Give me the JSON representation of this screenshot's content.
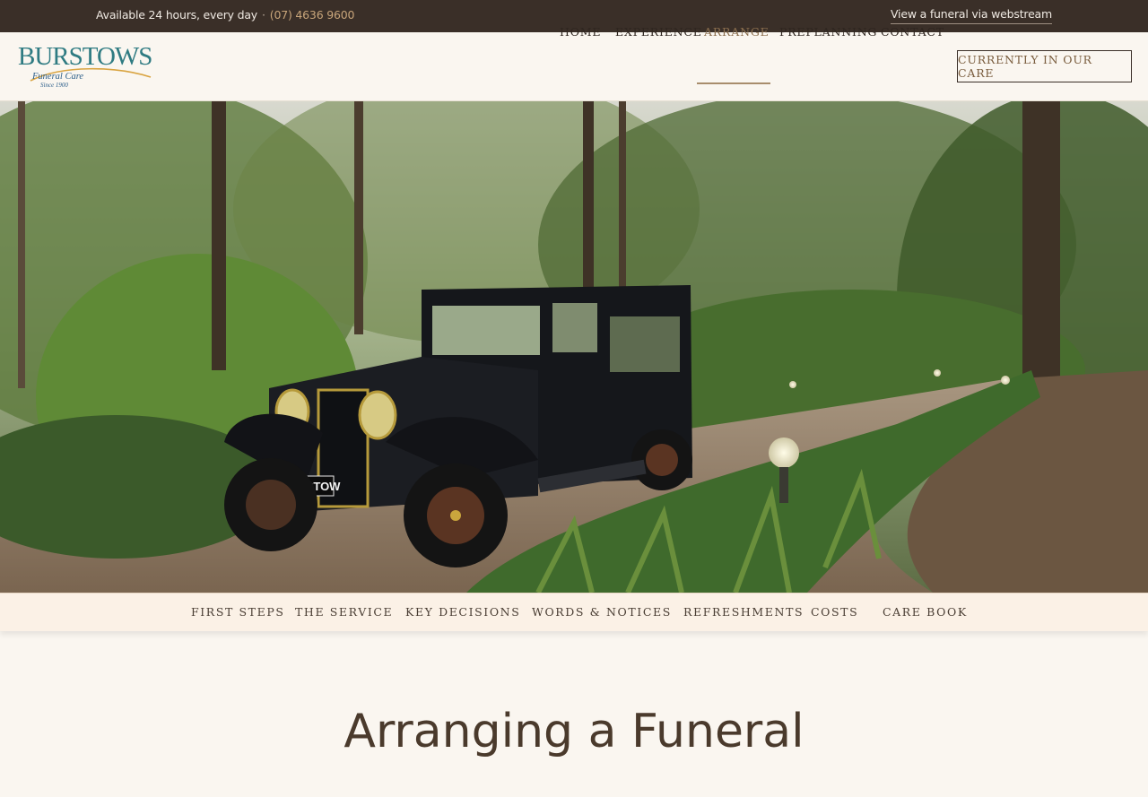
{
  "topbar": {
    "availability": "Available 24 hours, every day",
    "separator": "·",
    "phone": "(07) 4636 9600",
    "webstream_link": "View a funeral via webstream"
  },
  "logo": {
    "brand": "BURSTOWS",
    "subtitle": "Funeral Care",
    "since": "Since 1900",
    "brand_color": "#2f7b82"
  },
  "nav": {
    "items": [
      {
        "label": "HOME"
      },
      {
        "label": "EXPERIENCE"
      },
      {
        "label": "ARRANGE",
        "active": true
      },
      {
        "label": "PREPLANNING"
      },
      {
        "label": "CONTACT"
      }
    ],
    "cta": "CURRENTLY IN OUR CARE"
  },
  "hero": {
    "plate_text": "BURSTOW"
  },
  "subnav": {
    "items": [
      {
        "label": "FIRST STEPS"
      },
      {
        "label": "THE SERVICE"
      },
      {
        "label": "KEY DECISIONS"
      },
      {
        "label": "WORDS & NOTICES"
      },
      {
        "label": "REFRESHMENTS"
      },
      {
        "label": "COSTS"
      },
      {
        "label": "CARE BOOK"
      }
    ]
  },
  "page": {
    "title": "Arranging a Funeral"
  },
  "colors": {
    "topbar_bg": "#3a2f28",
    "accent": "#a88d6c",
    "phone": "#c8a57a",
    "page_bg": "#faf6f0"
  }
}
